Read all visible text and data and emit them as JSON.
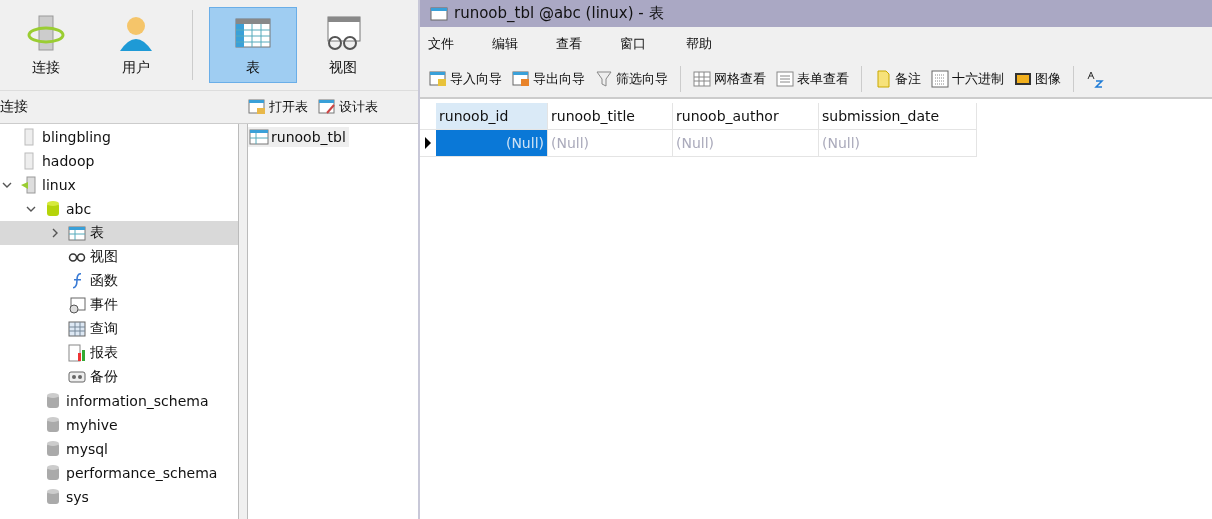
{
  "toolbar": [
    {
      "label": "连接",
      "kind": "connection",
      "selected": false
    },
    {
      "label": "用户",
      "kind": "user",
      "selected": false
    },
    {
      "label": "表",
      "kind": "table",
      "selected": true
    },
    {
      "label": "视图",
      "kind": "view",
      "selected": false
    }
  ],
  "connections_header": "连接",
  "object_actions": [
    {
      "label": "打开表",
      "kind": "open"
    },
    {
      "label": "设计表",
      "kind": "design"
    }
  ],
  "tree": [
    {
      "label": "blingbling",
      "kind": "server-off",
      "selected": false
    },
    {
      "label": "hadoop",
      "kind": "server-off",
      "selected": false
    },
    {
      "label": "linux",
      "kind": "server-on",
      "expanded": true,
      "selected": false,
      "children": [
        {
          "label": "abc",
          "kind": "database-open",
          "expanded": true,
          "selected": false,
          "children": [
            {
              "label": "表",
              "kind": "table",
              "expanded": false,
              "selected": true
            },
            {
              "label": "视图",
              "kind": "view",
              "selected": false
            },
            {
              "label": "函数",
              "kind": "function",
              "selected": false
            },
            {
              "label": "事件",
              "kind": "event",
              "selected": false
            },
            {
              "label": "查询",
              "kind": "query",
              "selected": false
            },
            {
              "label": "报表",
              "kind": "report",
              "selected": false
            },
            {
              "label": "备份",
              "kind": "backup",
              "selected": false
            }
          ]
        },
        {
          "label": "information_schema",
          "kind": "database",
          "selected": false
        },
        {
          "label": "myhive",
          "kind": "database",
          "selected": false
        },
        {
          "label": "mysql",
          "kind": "database",
          "selected": false
        },
        {
          "label": "performance_schema",
          "kind": "database",
          "selected": false
        },
        {
          "label": "sys",
          "kind": "database",
          "selected": false
        }
      ]
    }
  ],
  "objects": [
    {
      "label": "runoob_tbl",
      "selected": true
    }
  ],
  "window": {
    "title": "runoob_tbl @abc (linux) - 表",
    "menu": [
      "文件",
      "编辑",
      "查看",
      "窗口",
      "帮助"
    ],
    "toolbar": [
      {
        "label": "导入向导",
        "kind": "import"
      },
      {
        "label": "导出向导",
        "kind": "export"
      },
      {
        "label": "筛选向导",
        "kind": "filter"
      },
      {
        "kind": "separator"
      },
      {
        "label": "网格查看",
        "kind": "grid"
      },
      {
        "label": "表单查看",
        "kind": "form"
      },
      {
        "kind": "separator"
      },
      {
        "label": "备注",
        "kind": "note"
      },
      {
        "label": "十六进制",
        "kind": "hex"
      },
      {
        "label": "图像",
        "kind": "image"
      },
      {
        "kind": "separator"
      },
      {
        "kind": "sort"
      }
    ],
    "table": {
      "columns": [
        {
          "label": "runoob_id",
          "selected": true
        },
        {
          "label": "runoob_title",
          "selected": false
        },
        {
          "label": "runoob_author",
          "selected": false
        },
        {
          "label": "submission_date",
          "selected": false
        }
      ],
      "rows": [
        {
          "current": true,
          "cells": [
            {
              "text": "(Null)",
              "selected": true
            },
            {
              "text": "(Null)",
              "selected": false
            },
            {
              "text": "(Null)",
              "selected": false
            },
            {
              "text": "(Null)",
              "selected": false
            }
          ]
        }
      ]
    }
  }
}
